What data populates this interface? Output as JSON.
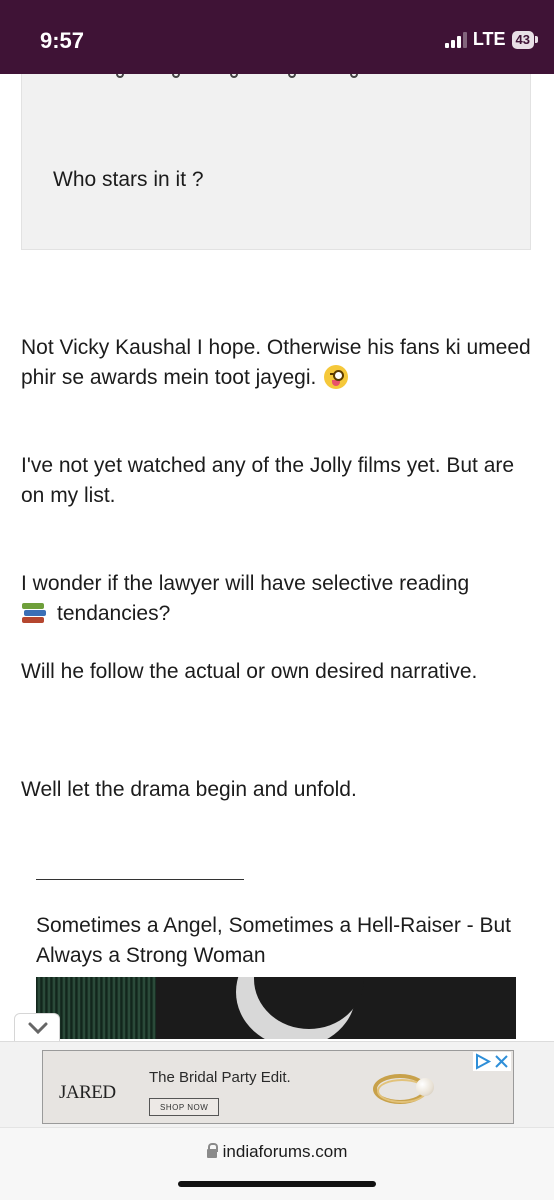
{
  "status_bar": {
    "time": "9:57",
    "network": "LTE",
    "battery": "43",
    "icons": [
      "signal-icon",
      "battery-icon"
    ]
  },
  "post": {
    "quote": "Who stars in it ?",
    "paragraphs": {
      "p1": "Not Vicky Kaushal I hope. Otherwise his fans ki umeed phir se awards mein toot jayegi.",
      "p2": "I've not yet watched any of the Jolly films yet. But are on my list.",
      "p3_line1": "I wonder if the lawyer will have selective reading",
      "p3_line2": "tendancies?",
      "p4": "Will he follow the actual or own desired narrative.",
      "p5": "Well let the drama begin and unfold."
    },
    "emoji": [
      "winking-tongue-emoji",
      "books-emoji"
    ]
  },
  "signature": {
    "text": "Sometimes a Angel, Sometimes a Hell-Raiser - But Always a Strong Woman"
  },
  "ad": {
    "brand": "JARED",
    "headline": "The Bridal Party Edit.",
    "cta": "SHOP NOW"
  },
  "browser": {
    "url": "indiaforums.com"
  }
}
